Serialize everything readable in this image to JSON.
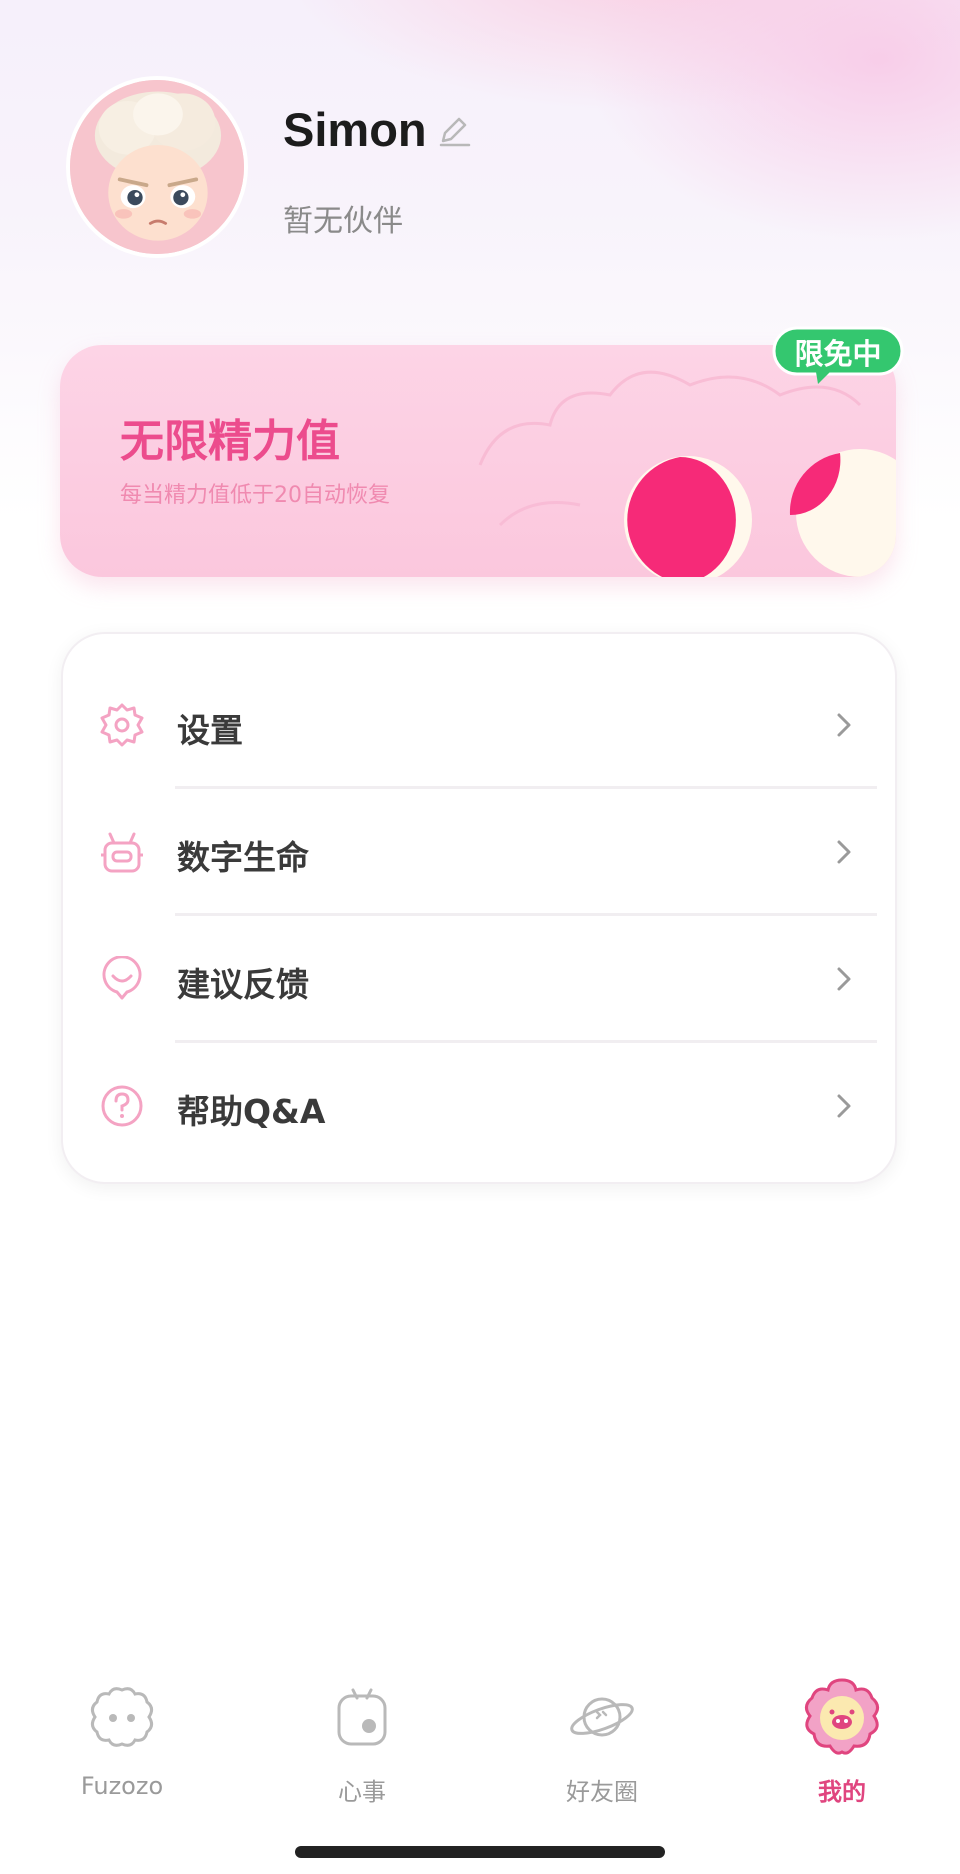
{
  "profile": {
    "name": "Simon",
    "partner_status": "暂无伙伴",
    "edit_icon": "pencil-icon"
  },
  "energy": {
    "title": "无限精力值",
    "subtitle": "每当精力值低于20自动恢复",
    "badge": "限免中",
    "badge_color": "#34c76f",
    "title_color": "#ec4c8d"
  },
  "menu": {
    "items": [
      {
        "label": "设置",
        "icon": "gear-icon"
      },
      {
        "label": "数字生命",
        "icon": "robot-icon"
      },
      {
        "label": "建议反馈",
        "icon": "smile-bubble-icon"
      },
      {
        "label": "帮助Q&A",
        "icon": "question-icon"
      }
    ]
  },
  "tabbar": {
    "tabs": [
      {
        "label": "Fuzozo",
        "icon": "fluffy-face-icon",
        "active": false
      },
      {
        "label": "心事",
        "icon": "mood-note-icon",
        "active": false
      },
      {
        "label": "好友圈",
        "icon": "planet-icon",
        "active": false
      },
      {
        "label": "我的",
        "icon": "flower-face-icon",
        "active": true
      }
    ],
    "active_color": "#e0457f"
  }
}
